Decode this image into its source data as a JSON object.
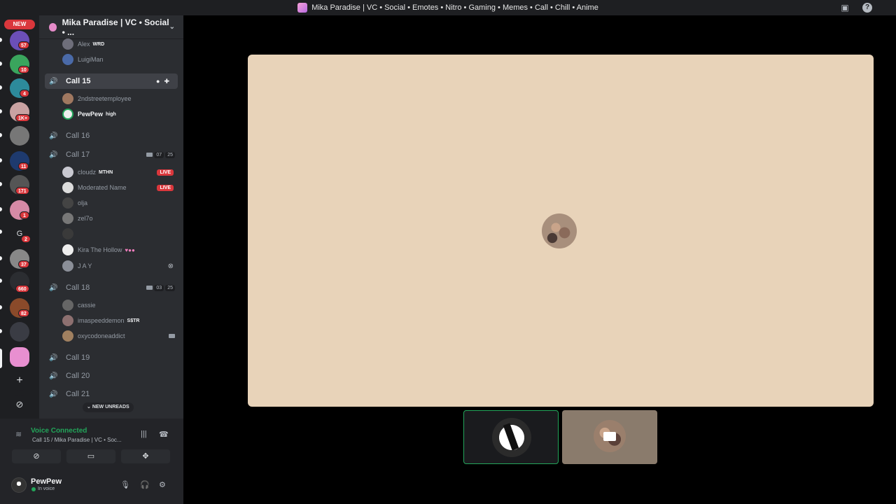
{
  "window": {
    "title": "Mika Paradise | VC • Social • Emotes • Nitro • Gaming • Memes • Call • Chill • Anime"
  },
  "servers": {
    "new_label": "NEW",
    "badges": [
      "57",
      "10",
      "4",
      "1K+",
      "11",
      "171",
      "1",
      "2",
      "37",
      "660",
      "82"
    ],
    "letter_server": "G"
  },
  "guild": {
    "name": "Mika Paradise | VC • Social • ..."
  },
  "channels": [
    {
      "type": "user",
      "name": "Alex",
      "tag": "WRD"
    },
    {
      "type": "user",
      "name": "LuigiMan"
    },
    {
      "type": "channel",
      "name": "Call 15",
      "active": true
    },
    {
      "type": "user",
      "name": "2ndstreetemployee"
    },
    {
      "type": "user",
      "name": "PewPew",
      "tag": "high",
      "bright": true
    },
    {
      "type": "channel",
      "name": "Call 16"
    },
    {
      "type": "channel",
      "name": "Call 17",
      "count_a": "07",
      "count_b": "25"
    },
    {
      "type": "user",
      "name": "cloudz",
      "tag": "MTHN",
      "live": "LIVE"
    },
    {
      "type": "user",
      "name": "Moderated Name",
      "live": "LIVE"
    },
    {
      "type": "user",
      "name": "olja"
    },
    {
      "type": "user",
      "name": "zel7o"
    },
    {
      "type": "user",
      "name": ""
    },
    {
      "type": "user",
      "name": "Kira The Hollow"
    },
    {
      "type": "user",
      "name": "J A Y"
    },
    {
      "type": "channel",
      "name": "Call 18",
      "count_a": "03",
      "count_b": "25"
    },
    {
      "type": "user",
      "name": "cassie"
    },
    {
      "type": "user",
      "name": "imaspeeddemon",
      "tag": "S$TR"
    },
    {
      "type": "user",
      "name": "oxycodoneaddict"
    },
    {
      "type": "channel",
      "name": "Call 19"
    },
    {
      "type": "channel",
      "name": "Call 20"
    },
    {
      "type": "channel",
      "name": "Call 21"
    }
  ],
  "new_unreads": "NEW UNREADS",
  "voice": {
    "status": "Voice Connected",
    "location": "Call 15 / Mika Paradise | VC • Soc..."
  },
  "me": {
    "name": "PewPew",
    "status": "In voice"
  },
  "colors": {
    "accent_green": "#23a55a",
    "danger_red": "#da373c",
    "stage_tile": "#e8d3b9"
  }
}
